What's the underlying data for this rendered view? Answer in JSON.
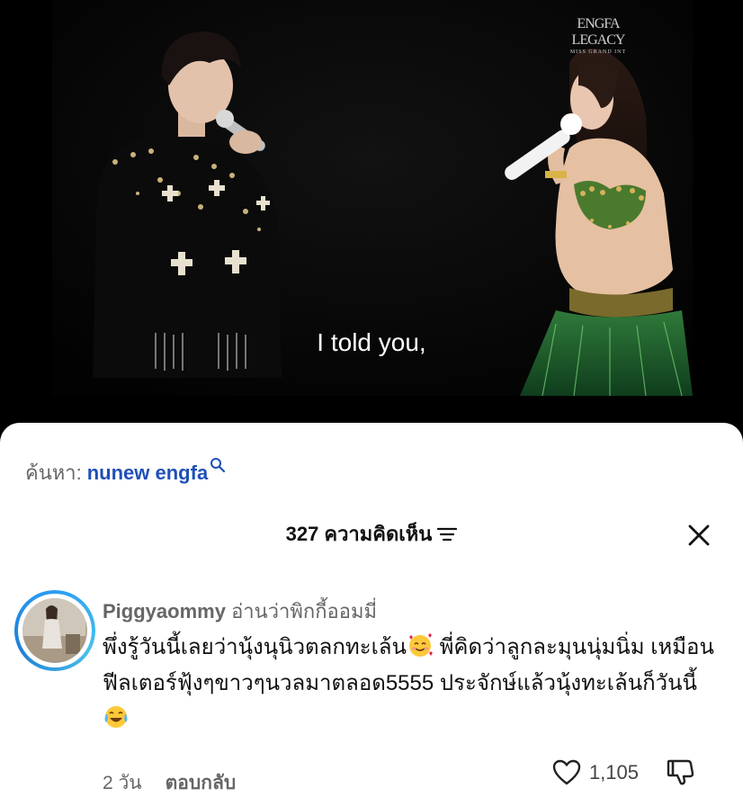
{
  "video": {
    "watermark_line1": "ENGFA",
    "watermark_line2": "LEGACY",
    "watermark_line3": "MISS GRAND INT",
    "subtitle": "I told you,"
  },
  "search": {
    "label": "ค้นหา:",
    "query": "nunew engfa"
  },
  "comments_header": {
    "count": "327",
    "label": "ความคิดเห็น"
  },
  "comment": {
    "username": "Piggyaommy",
    "username_note": "อ่านว่าพิกกี้ออมมี่",
    "text_part1": "พึ่งรู้วันนี้เลยว่านุ้งนุนิวตลกทะเล้น",
    "text_part2": " พี่คิดว่าลูกละมุนนุ่มนิ่ม เหมือนฟีลเตอร์ฟุ้งๆขาวๆนวลมาตลอด5555 ประจักษ์แล้วนุ้งทะเล้นก็วันนี้",
    "time": "2 วัน",
    "reply_label": "ตอบกลับ",
    "like_count": "1,105"
  },
  "icons": {
    "search": "search-icon",
    "filter": "filter-icon",
    "close": "close-icon",
    "heart": "heart-icon",
    "dislike": "thumbs-down-icon",
    "emoji1": "smiling-face-with-hearts-icon",
    "emoji2": "tears-of-joy-icon"
  },
  "colors": {
    "link_blue": "#1f4fb8",
    "avatar_ring": "#2a9df4"
  }
}
